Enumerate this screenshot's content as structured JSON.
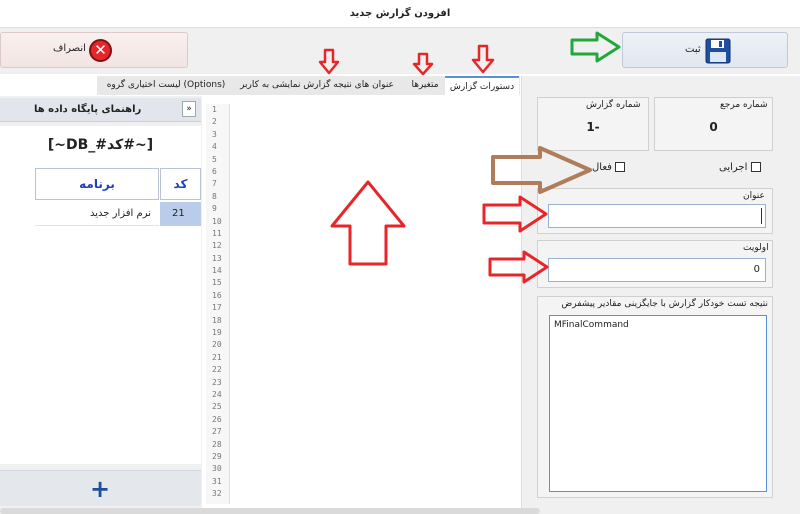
{
  "window": {
    "title": "افزودن گزارش جدید"
  },
  "toolbar": {
    "cancel_label": "انصراف",
    "save_label": "ثبت"
  },
  "tabs": [
    {
      "label": "دستورات گزارش",
      "active": true
    },
    {
      "label": "متغیرها",
      "active": false
    },
    {
      "label": "عنوان های نتیجه گزارش نمایشی به کاربر",
      "active": false
    },
    {
      "label": "لیست اختیاری گروه (Options)",
      "active": false
    }
  ],
  "db_guide": {
    "title": "راهنمای پایگاه داده ها",
    "collapse_symbol": "»",
    "token": "[~DB_#کد#~]",
    "columns": [
      "کد",
      "برنامه"
    ],
    "rows": [
      {
        "code": "21",
        "name": "نرم افزار جدید"
      }
    ],
    "add_symbol": "+"
  },
  "editor": {
    "line_numbers": [
      "1",
      "2",
      "3",
      "4",
      "5",
      "6",
      "7",
      "8",
      "9",
      "10",
      "11",
      "12",
      "13",
      "14",
      "15",
      "16",
      "17",
      "18",
      "19",
      "20",
      "21",
      "22",
      "23",
      "24",
      "25",
      "26",
      "27",
      "28",
      "29",
      "30",
      "31",
      "32"
    ]
  },
  "form": {
    "ref_number_label": "شماره مرجع",
    "ref_number_value": "0",
    "report_number_label": "شماره گزارش",
    "report_number_value": "1-",
    "executive_label": "اجرایی",
    "active_label": "فعال",
    "title_label": "عنوان",
    "title_value": "",
    "priority_label": "اولویت",
    "priority_value": "0",
    "result_label": "نتیجه تست خودکار گزارش با جایگزینی مقادیر پیشفرض",
    "result_value": "MFinalCommand"
  },
  "colors": {
    "accent": "#5b8fd6",
    "cancel_icon": "#e8262a",
    "annotation_red_arrow": "#e8262a",
    "annotation_green_arrow": "#22a83a",
    "annotation_brown_arrow": "#b07d5a"
  }
}
